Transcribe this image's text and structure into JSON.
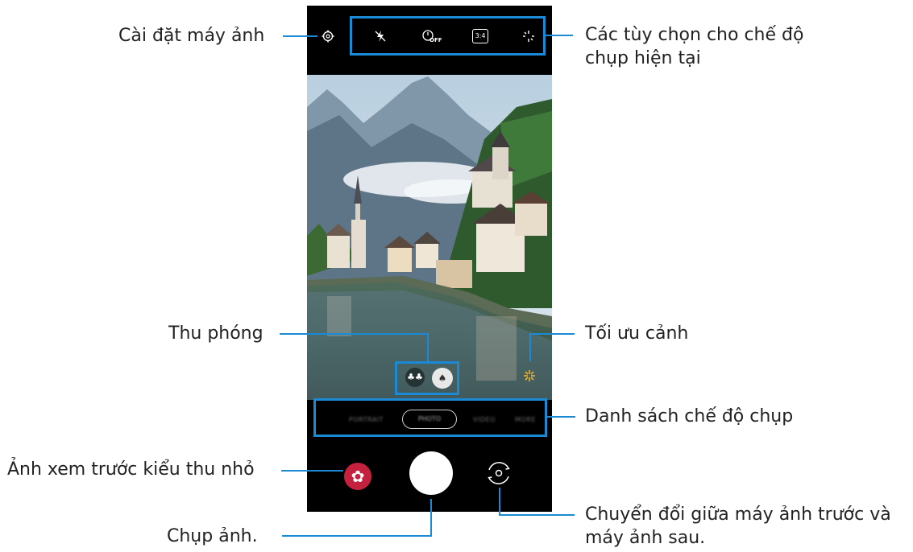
{
  "callouts": {
    "settings": "Cài đặt máy ảnh",
    "options_line1": "Các tùy chọn cho chế độ",
    "options_line2": "chụp hiện tại",
    "zoom": "Thu phóng",
    "scene_optimizer": "Tối ưu cảnh",
    "mode_list": "Danh sách chế độ chụp",
    "preview_thumbnail": "Ảnh xem trước kiểu thu nhỏ",
    "switch_line1": "Chuyển đổi giữa máy ảnh trước và",
    "switch_line2": "máy ảnh sau.",
    "capture": "Chụp ảnh."
  },
  "camera": {
    "ratio_label": "3:4",
    "timer_label": "OFF",
    "modes": [
      "PORTRAIT",
      "PHOTO",
      "VIDEO",
      "MORE"
    ],
    "selected_mode": "PHOTO"
  },
  "colors": {
    "accent": "#1a8ad4",
    "gallery_thumb": "#c4213e",
    "scene_optimizer": "#f0b429"
  },
  "icons": {
    "settings": "gear-icon",
    "flash": "flash-off-icon",
    "timer": "timer-icon",
    "ratio": "aspect-ratio-icon",
    "effects": "sparkle-icon",
    "zoom_wide": "trees-icon",
    "zoom_normal": "tree-icon",
    "scene": "scene-optimizer-icon",
    "switch": "switch-camera-icon"
  }
}
